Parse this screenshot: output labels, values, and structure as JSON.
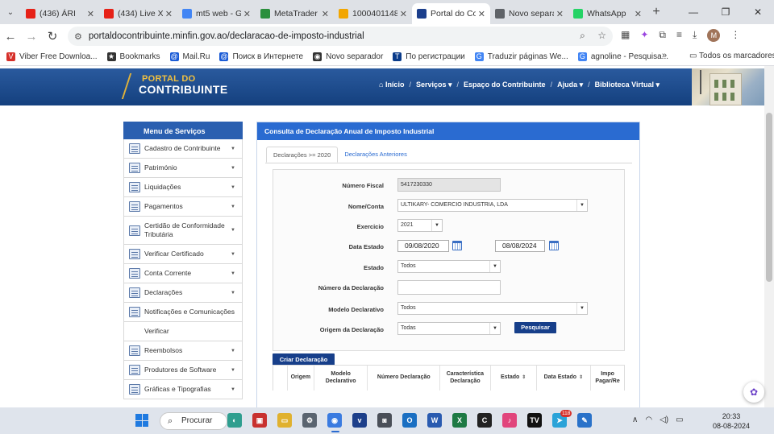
{
  "browser": {
    "tabs": [
      {
        "title": "(436) ÁRI",
        "color": "#e62117",
        "active": false
      },
      {
        "title": "(434) Live XA",
        "color": "#e62117",
        "active": false
      },
      {
        "title": "mt5 web - G",
        "color": "#4285f4",
        "active": false
      },
      {
        "title": "MetaTrader",
        "color": "#2a8f3c",
        "active": false
      },
      {
        "title": "1000401148",
        "color": "#f2a600",
        "active": false
      },
      {
        "title": "Portal do Co",
        "color": "#1c3f8c",
        "active": true
      },
      {
        "title": "Novo separa",
        "color": "#5f6368",
        "active": false
      },
      {
        "title": "WhatsApp",
        "color": "#25d366",
        "active": false
      }
    ],
    "url": "portaldocontribuinte.minfin.gov.ao/declaracao-de-imposto-industrial",
    "bookmarks": [
      {
        "label": "Viber Free Downloa...",
        "color": "#d6302a",
        "icon": "V"
      },
      {
        "label": "Bookmarks",
        "color": "#333333",
        "icon": "★"
      },
      {
        "label": "Mail.Ru",
        "color": "#1a5bd6",
        "icon": "@"
      },
      {
        "label": "Поиск в Интернете",
        "color": "#1a5bd6",
        "icon": "@"
      },
      {
        "label": "Novo separador",
        "color": "#333333",
        "icon": "◉"
      },
      {
        "label": "По регистрации",
        "color": "#0a3b8a",
        "icon": "T"
      },
      {
        "label": "Traduzir páginas We...",
        "color": "#4285f4",
        "icon": "G"
      },
      {
        "label": "agnoline - Pesquisa...",
        "color": "#4285f4",
        "icon": "G"
      }
    ],
    "bookmarks_all": "Todos os marcadores",
    "profile_initial": "M"
  },
  "header": {
    "logo_top": "PORTAL DO",
    "logo_bottom": "CONTRIBUINTE",
    "nav": [
      "Início",
      "Serviços",
      "Espaço do Contribuinte",
      "Ajuda",
      "Biblioteca Virtual"
    ]
  },
  "sidebar": {
    "title": "Menu de Serviços",
    "items": [
      {
        "label": "Cadastro de Contribuinte",
        "caret": true,
        "icon": "registry-icon"
      },
      {
        "label": "Património",
        "caret": true,
        "icon": "property-icon"
      },
      {
        "label": "Liquidações",
        "caret": true,
        "icon": "settlement-icon"
      },
      {
        "label": "Pagamentos",
        "caret": true,
        "icon": "payment-icon"
      },
      {
        "label": "Certidão de Conformidade Tributária",
        "caret": true,
        "icon": "certificate-icon"
      },
      {
        "label": "Verificar Certificado",
        "caret": true,
        "icon": "verify-icon"
      },
      {
        "label": "Conta Corrente",
        "caret": true,
        "icon": "account-icon"
      },
      {
        "label": "Declarações",
        "caret": true,
        "icon": "declaration-icon"
      },
      {
        "label": "Notificações e Comunicações",
        "caret": false,
        "icon": "notification-icon"
      },
      {
        "label": "Verificar",
        "caret": false,
        "icon": ""
      },
      {
        "label": "Reembolsos",
        "caret": true,
        "icon": "bank-icon"
      },
      {
        "label": "Produtores de Software",
        "caret": true,
        "icon": "software-icon"
      },
      {
        "label": "Gráficas e Tipografias",
        "caret": true,
        "icon": "printer-icon"
      }
    ]
  },
  "main": {
    "panel_title": "Consulta de Declaração Anual de Imposto Industrial",
    "tabs": [
      "Declarações >= 2020",
      "Declarações Anteriores"
    ],
    "form": {
      "numero_fiscal_label": "Número Fiscal",
      "numero_fiscal_value": "5417230330",
      "nome_label": "Nome/Conta",
      "nome_value": "ULTIKARY- COMERCIO INDUSTRIA, LDA",
      "exercicio_label": "Exercicio",
      "exercicio_value": "2021",
      "data_estado_label": "Data Estado",
      "data_from": "09/08/2020",
      "data_to": "08/08/2024",
      "estado_label": "Estado",
      "estado_value": "Todos",
      "numero_declaracao_label": "Número da Declaração",
      "numero_declaracao_value": "",
      "modelo_label": "Modelo Declarativo",
      "modelo_value": "Todos",
      "origem_label": "Origem da Declaração",
      "origem_value": "Todas",
      "pesquisar_label": "Pesquisar"
    },
    "criar_label": "Criar Declaração",
    "table_headers": [
      "Origem",
      "Modelo Declarativo",
      "Número Declaração",
      "Característica Declaração",
      "Estado",
      "Data Estado",
      "Impo Pagar/Re"
    ]
  },
  "taskbar": {
    "search_label": "Procurar",
    "apps": [
      {
        "name": "copilot-icon",
        "color": "#2f9e8f",
        "label": "◐"
      },
      {
        "name": "photos-icon",
        "color": "#c8312f",
        "label": "▣"
      },
      {
        "name": "file-explorer-icon",
        "color": "#e0b12f",
        "label": "▭"
      },
      {
        "name": "settings-icon",
        "color": "#5a6470",
        "label": "⚙"
      },
      {
        "name": "chrome-icon",
        "color": "#3a7be0",
        "label": "◉"
      },
      {
        "name": "vio-icon",
        "color": "#1d3f8a",
        "label": "v"
      },
      {
        "name": "camera-icon",
        "color": "#4a4f58",
        "label": "◙"
      },
      {
        "name": "outlook-icon",
        "color": "#1a6fc2",
        "label": "O"
      },
      {
        "name": "word-icon",
        "color": "#2a5bb0",
        "label": "W"
      },
      {
        "name": "excel-icon",
        "color": "#1e7a44",
        "label": "X"
      },
      {
        "name": "ccleaner-icon",
        "color": "#222222",
        "label": "C"
      },
      {
        "name": "itunes-icon",
        "color": "#e1457c",
        "label": "♪"
      },
      {
        "name": "tradingview-icon",
        "color": "#111111",
        "label": "TV"
      },
      {
        "name": "telegram-icon",
        "color": "#2aa3d8",
        "label": "➤"
      },
      {
        "name": "paint-icon",
        "color": "#2a72c9",
        "label": "✎"
      }
    ],
    "telegram_badge": "118",
    "time": "20:33",
    "date": "08-08-2024"
  }
}
